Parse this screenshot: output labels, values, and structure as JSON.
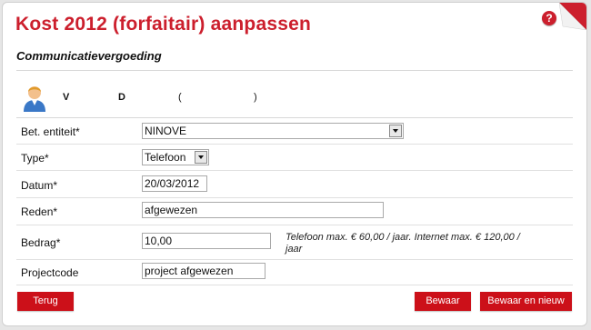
{
  "header": {
    "title": "Kost 2012 (forfaitair) aanpassen",
    "help_glyph": "?"
  },
  "section": {
    "subtitle": "Communicatievergoeding"
  },
  "user": {
    "initial_1": "V",
    "initial_2": "D",
    "paren_open": "(",
    "paren_close": ")"
  },
  "form": {
    "entity": {
      "label": "Bet. entiteit*",
      "value": "NINOVE"
    },
    "type": {
      "label": "Type*",
      "value": "Telefoon"
    },
    "date": {
      "label": "Datum*",
      "value": "20/03/2012"
    },
    "reason": {
      "label": "Reden*",
      "value": "afgewezen"
    },
    "amount": {
      "label": "Bedrag*",
      "value": "10,00",
      "hint": "Telefoon max. € 60,00 / jaar. Internet max. € 120,00 / jaar"
    },
    "project": {
      "label": "Projectcode",
      "value": "project afgewezen"
    }
  },
  "buttons": {
    "back": "Terug",
    "save": "Bewaar",
    "save_new": "Bewaar en nieuw"
  },
  "colors": {
    "accent": "#cc1f2d",
    "button": "#cc1019"
  }
}
